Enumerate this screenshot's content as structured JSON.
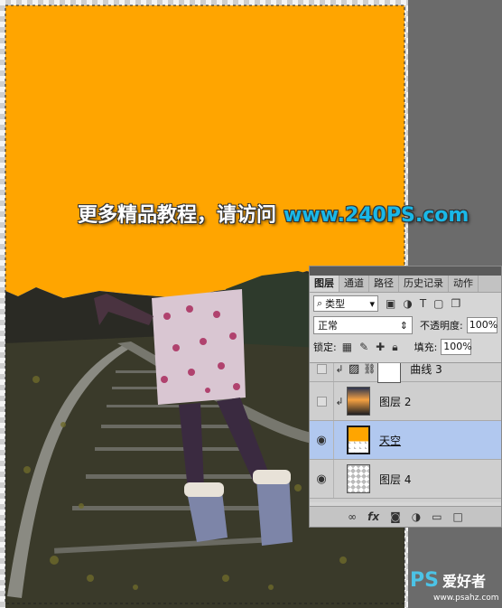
{
  "watermark": {
    "text_cn": "更多精品教程，请访问",
    "url": "www.240PS.com"
  },
  "colors": {
    "sky_fill": "#ffa500",
    "selected_layer": "#b1c8ef",
    "panel_bg": "#d6d6d6",
    "watermark_url": "#19b8e8"
  },
  "layers_panel": {
    "tabs": [
      "图层",
      "通道",
      "路径",
      "历史记录",
      "动作"
    ],
    "active_tab": "图层",
    "filter": {
      "icon": "search-icon",
      "label": "类型"
    },
    "blend_mode": "正常",
    "opacity_label": "不透明度:",
    "opacity_value": "100%",
    "lock_label": "锁定:",
    "fill_label": "填充:",
    "fill_value": "100%",
    "layers": [
      {
        "name": "曲线 3",
        "type": "adjustment-curves",
        "visible": false,
        "clipped": true,
        "selected": false
      },
      {
        "name": "图层 2",
        "type": "pixel",
        "visible": false,
        "clipped": true,
        "selected": false
      },
      {
        "name": "天空",
        "type": "pixel",
        "visible": true,
        "clipped": false,
        "selected": true
      },
      {
        "name": "图层 4",
        "type": "pixel",
        "visible": true,
        "clipped": false,
        "selected": false
      }
    ],
    "footer_icons": [
      "link-icon",
      "fx-icon",
      "mask-icon",
      "adjustment-icon",
      "folder-icon",
      "new-layer-icon"
    ]
  },
  "site_logo": {
    "brand": "PS",
    "brand_cn": "爱好者",
    "url": "www.psahz.com"
  }
}
